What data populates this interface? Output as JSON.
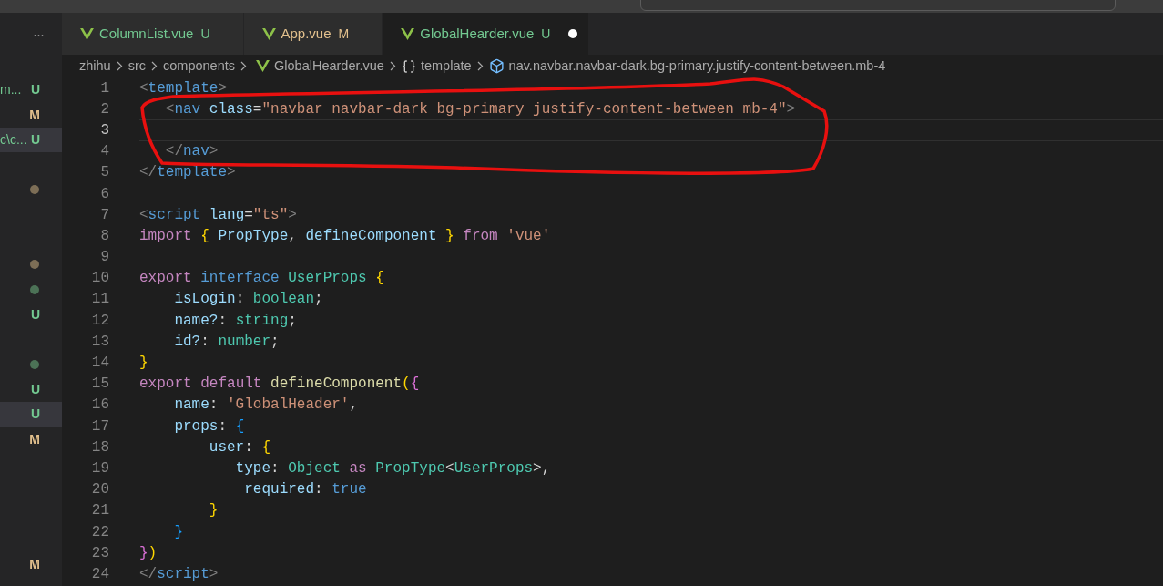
{
  "sidebar": {
    "more": "···",
    "rows": [
      {
        "kind": "badge",
        "label": "m...",
        "badge": "U",
        "color": "#73c991",
        "selected": false
      },
      {
        "kind": "badge",
        "badge": "M",
        "color": "#e2c08d",
        "selected": false
      },
      {
        "kind": "badge",
        "label": "c\\c...",
        "badge": "U",
        "color": "#73c991",
        "selected": true
      },
      {
        "kind": "empty",
        "selected": false
      },
      {
        "kind": "dot",
        "color": "#7d6e56",
        "selected": false
      },
      {
        "kind": "empty",
        "selected": false
      },
      {
        "kind": "empty",
        "selected": false
      },
      {
        "kind": "dot",
        "color": "#7d6e56",
        "selected": false
      },
      {
        "kind": "dot",
        "color": "#4c7256",
        "selected": false
      },
      {
        "kind": "badge",
        "badge": "U",
        "color": "#73c991",
        "selected": false
      },
      {
        "kind": "empty",
        "selected": false
      },
      {
        "kind": "dot",
        "color": "#4c7256",
        "selected": false
      },
      {
        "kind": "badge",
        "badge": "U",
        "color": "#73c991",
        "selected": false
      },
      {
        "kind": "badge",
        "badge": "U",
        "color": "#73c991",
        "selected": true
      },
      {
        "kind": "badge",
        "badge": "M",
        "color": "#e2c08d",
        "selected": false
      },
      {
        "kind": "empty",
        "selected": false
      },
      {
        "kind": "empty",
        "selected": false
      },
      {
        "kind": "empty",
        "selected": false
      },
      {
        "kind": "empty",
        "selected": false
      },
      {
        "kind": "badge",
        "badge": "M",
        "color": "#e2c08d",
        "selected": false
      }
    ]
  },
  "tabs": [
    {
      "label": "ColumnList.vue",
      "status": "U",
      "color": "#73c991",
      "dirty": false,
      "selected": false
    },
    {
      "label": "App.vue",
      "status": "M",
      "color": "#e2c08d",
      "dirty": false,
      "selected": false
    },
    {
      "label": "GlobalHearder.vue",
      "status": "U",
      "color": "#73c991",
      "dirty": true,
      "selected": true
    }
  ],
  "breadcrumb": [
    {
      "label": "zhihu",
      "kind": "folder"
    },
    {
      "label": "src",
      "kind": "folder"
    },
    {
      "label": "components",
      "kind": "folder"
    },
    {
      "label": "GlobalHearder.vue",
      "kind": "file"
    },
    {
      "label": "template",
      "kind": "block"
    },
    {
      "label": "nav.navbar.navbar-dark.bg-primary.justify-content-between.mb-4",
      "kind": "symbol"
    }
  ],
  "editor": {
    "lines": [
      {
        "number": "1",
        "current": false,
        "tokens": [
          {
            "t": "<",
            "color": "#808080"
          },
          {
            "t": "template",
            "color": "#569cd6"
          },
          {
            "t": ">",
            "color": "#808080"
          }
        ]
      },
      {
        "number": "2",
        "current": false,
        "tokens": [
          {
            "t": "   <",
            "color": "#808080"
          },
          {
            "t": "nav ",
            "color": "#569cd6"
          },
          {
            "t": "class",
            "color": "#9cdcfe"
          },
          {
            "t": "=",
            "color": "#d4d4d4"
          },
          {
            "t": "\"navbar navbar-dark bg-primary justify-content-between mb-4\"",
            "color": "#ce9178"
          },
          {
            "t": ">",
            "color": "#808080"
          }
        ]
      },
      {
        "number": "3",
        "current": true
      },
      {
        "number": "4",
        "current": false,
        "tokens": [
          {
            "t": "   </",
            "color": "#808080"
          },
          {
            "t": "nav",
            "color": "#569cd6"
          },
          {
            "t": ">",
            "color": "#808080"
          }
        ]
      },
      {
        "number": "5",
        "current": false,
        "tokens": [
          {
            "t": "</",
            "color": "#808080"
          },
          {
            "t": "template",
            "color": "#569cd6"
          },
          {
            "t": ">",
            "color": "#808080"
          }
        ]
      },
      {
        "number": "6",
        "current": false
      },
      {
        "number": "7",
        "current": false,
        "tokens": [
          {
            "t": "<",
            "color": "#808080"
          },
          {
            "t": "script ",
            "color": "#569cd6"
          },
          {
            "t": "lang",
            "color": "#9cdcfe"
          },
          {
            "t": "=",
            "color": "#d4d4d4"
          },
          {
            "t": "\"ts\"",
            "color": "#ce9178"
          },
          {
            "t": ">",
            "color": "#808080"
          }
        ]
      },
      {
        "number": "8",
        "current": false,
        "tokens": [
          {
            "t": "import ",
            "color": "#c586c0"
          },
          {
            "t": "{",
            "color": "#ffd700"
          },
          {
            "t": " PropType",
            "color": "#9cdcfe"
          },
          {
            "t": ","
          },
          {
            "t": " defineComponent ",
            "color": "#9cdcfe"
          },
          {
            "t": "} ",
            "color": "#ffd700"
          },
          {
            "t": "from ",
            "color": "#c586c0"
          },
          {
            "t": "'vue'",
            "color": "#ce9178"
          }
        ]
      },
      {
        "number": "9",
        "current": false
      },
      {
        "number": "10",
        "current": false,
        "tokens": [
          {
            "t": "export ",
            "color": "#c586c0"
          },
          {
            "t": "interface ",
            "color": "#569cd6"
          },
          {
            "t": "UserProps ",
            "color": "#4ec9b0"
          },
          {
            "t": "{",
            "color": "#ffd700"
          }
        ]
      },
      {
        "number": "11",
        "current": false,
        "tokens": [
          {
            "t": "    isLogin",
            "color": "#9cdcfe"
          },
          {
            "t": ": ",
            "color": "#d4d4d4"
          },
          {
            "t": "boolean",
            "color": "#4ec9b0"
          },
          {
            "t": ";",
            "color": "#d4d4d4"
          }
        ]
      },
      {
        "number": "12",
        "current": false,
        "tokens": [
          {
            "t": "    name?",
            "color": "#9cdcfe"
          },
          {
            "t": ": ",
            "color": "#d4d4d4"
          },
          {
            "t": "string",
            "color": "#4ec9b0"
          },
          {
            "t": ";",
            "color": "#d4d4d4"
          }
        ]
      },
      {
        "number": "13",
        "current": false,
        "tokens": [
          {
            "t": "    id?",
            "color": "#9cdcfe"
          },
          {
            "t": ": ",
            "color": "#d4d4d4"
          },
          {
            "t": "number",
            "color": "#4ec9b0"
          },
          {
            "t": ";",
            "color": "#d4d4d4"
          }
        ]
      },
      {
        "number": "14",
        "current": false,
        "tokens": [
          {
            "t": "}",
            "color": "#ffd700"
          }
        ]
      },
      {
        "number": "15",
        "current": false,
        "tokens": [
          {
            "t": "export ",
            "color": "#c586c0"
          },
          {
            "t": "default ",
            "color": "#c586c0"
          },
          {
            "t": "defineComponent",
            "color": "#dcdcaa"
          },
          {
            "t": "(",
            "color": "#ffd700"
          },
          {
            "t": "{",
            "color": "#da70d6"
          }
        ]
      },
      {
        "number": "16",
        "current": false,
        "tokens": [
          {
            "t": "    name",
            "color": "#9cdcfe"
          },
          {
            "t": ": ",
            "color": "#d4d4d4"
          },
          {
            "t": "'GlobalHeader'",
            "color": "#ce9178"
          },
          {
            "t": ",",
            "color": "#d4d4d4"
          }
        ]
      },
      {
        "number": "17",
        "current": false,
        "tokens": [
          {
            "t": "    props",
            "color": "#9cdcfe"
          },
          {
            "t": ": ",
            "color": "#d4d4d4"
          },
          {
            "t": "{",
            "color": "#179fff"
          }
        ]
      },
      {
        "number": "18",
        "current": false,
        "tokens": [
          {
            "t": "        user",
            "color": "#9cdcfe"
          },
          {
            "t": ": ",
            "color": "#d4d4d4"
          },
          {
            "t": "{",
            "color": "#ffd700"
          }
        ]
      },
      {
        "number": "19",
        "current": false,
        "tokens": [
          {
            "t": "           type",
            "color": "#9cdcfe"
          },
          {
            "t": ": ",
            "color": "#d4d4d4"
          },
          {
            "t": "Object ",
            "color": "#4ec9b0"
          },
          {
            "t": "as ",
            "color": "#c586c0"
          },
          {
            "t": "PropType",
            "color": "#4ec9b0"
          },
          {
            "t": "<",
            "color": "#d4d4d4"
          },
          {
            "t": "UserProps",
            "color": "#4ec9b0"
          },
          {
            "t": ">",
            "color": "#d4d4d4"
          },
          {
            "t": ",",
            "color": "#d4d4d4"
          }
        ]
      },
      {
        "number": "20",
        "current": false,
        "tokens": [
          {
            "t": "            required",
            "color": "#9cdcfe"
          },
          {
            "t": ": ",
            "color": "#d4d4d4"
          },
          {
            "t": "true",
            "color": "#569cd6"
          }
        ]
      },
      {
        "number": "21",
        "current": false,
        "tokens": [
          {
            "t": "        }",
            "color": "#ffd700"
          }
        ]
      },
      {
        "number": "22",
        "current": false,
        "tokens": [
          {
            "t": "    }",
            "color": "#179fff"
          }
        ]
      },
      {
        "number": "23",
        "current": false,
        "tokens": [
          {
            "t": "}",
            "color": "#da70d6"
          },
          {
            "t": ")",
            "color": "#ffd700"
          }
        ]
      },
      {
        "number": "24",
        "current": false,
        "tokens": [
          {
            "t": "</",
            "color": "#808080"
          },
          {
            "t": "script",
            "color": "#569cd6"
          },
          {
            "t": ">",
            "color": "#808080"
          }
        ]
      }
    ]
  }
}
